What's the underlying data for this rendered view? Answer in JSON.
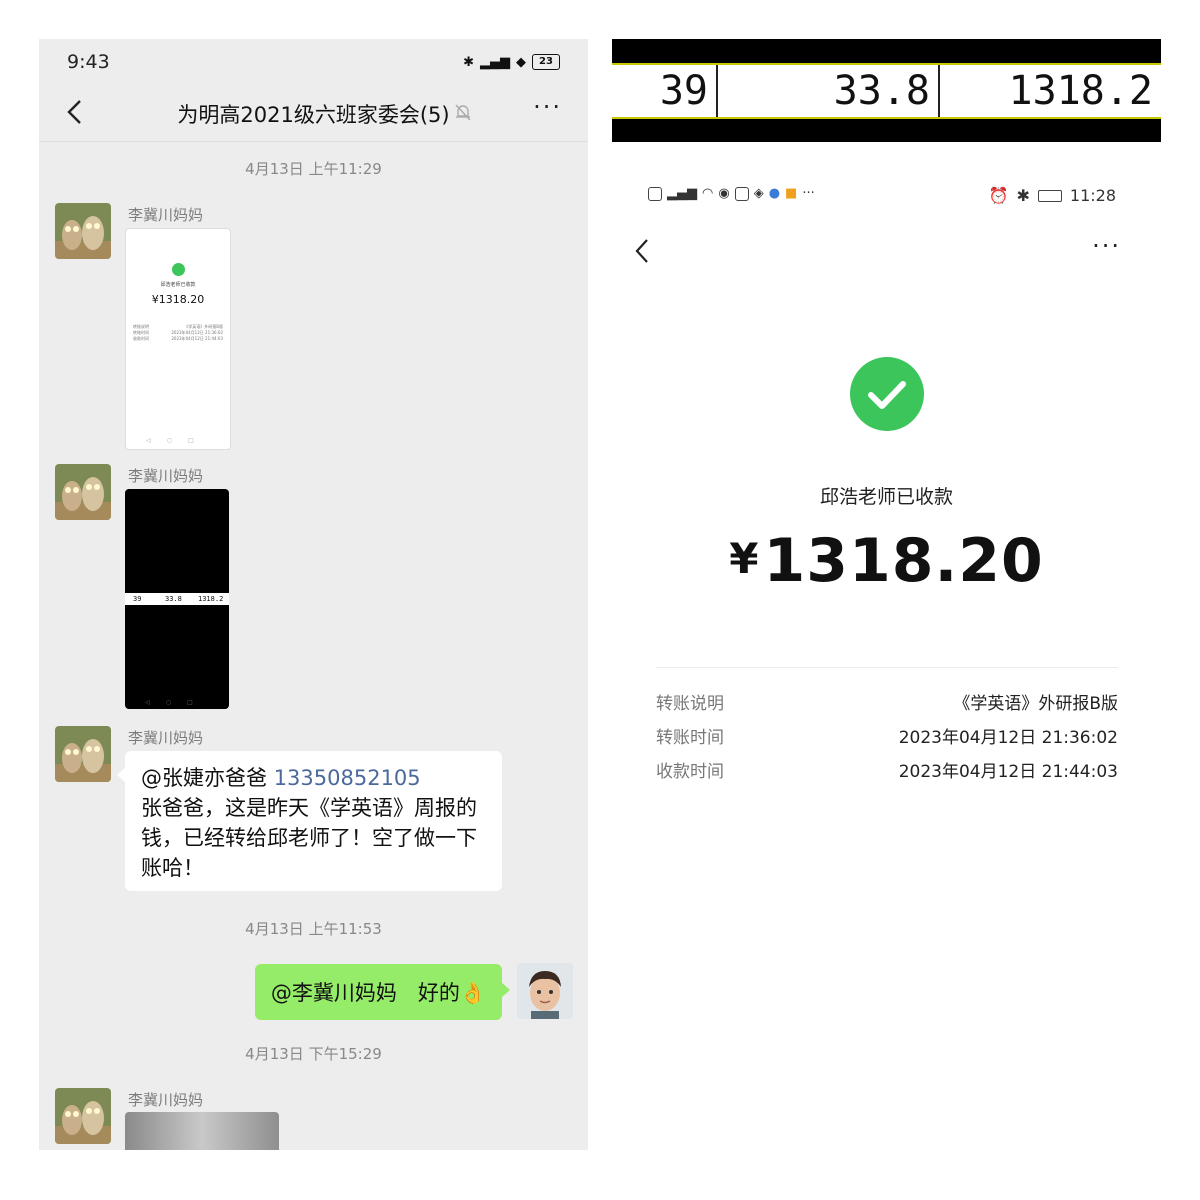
{
  "chat": {
    "status_bar": {
      "time": "9:43",
      "battery": "23"
    },
    "header": {
      "title": "为明高2021级六班家委会(5)"
    },
    "messages": [
      {
        "timestamp": "4月13日 上午11:29"
      },
      {
        "sender": "李冀川妈妈",
        "kind": "image",
        "thumb": {
          "check_title": "邱浩老师已收款",
          "amount": "¥1318.20",
          "rows": [
            {
              "k": "转账说明",
              "v": "《学英语》外研报B版"
            },
            {
              "k": "转账时间",
              "v": "2023年04月12日 21:36:02"
            },
            {
              "k": "收款时间",
              "v": "2023年04月12日 21:44:03"
            }
          ]
        }
      },
      {
        "sender": "李冀川妈妈",
        "kind": "image",
        "strip": [
          "39",
          "33.8",
          "1318.2"
        ]
      },
      {
        "sender": "李冀川妈妈",
        "kind": "text",
        "mention": "@张婕亦爸爸",
        "mention_number": "13350852105",
        "text": "张爸爸，这是昨天《学英语》周报的钱，已经转给邱老师了！空了做一下账哈！"
      },
      {
        "timestamp": "4月13日 上午11:53"
      },
      {
        "sender": "me",
        "kind": "text",
        "text": "@李冀川妈妈　好的👌"
      },
      {
        "timestamp": "4月13日 下午15:29"
      },
      {
        "sender": "李冀川妈妈",
        "kind": "image"
      }
    ]
  },
  "strip": {
    "cells": [
      "39",
      "33.8",
      "1318.2"
    ]
  },
  "payment": {
    "status_bar": {
      "time": "11:28"
    },
    "received_text": "邱浩老师已收款",
    "currency": "¥",
    "amount": "1318.20",
    "details": [
      {
        "label": "转账说明",
        "value": "《学英语》外研报B版"
      },
      {
        "label": "转账时间",
        "value": "2023年04月12日 21:36:02"
      },
      {
        "label": "收款时间",
        "value": "2023年04月12日 21:44:03"
      }
    ]
  },
  "colors": {
    "chat_bg": "#ededed",
    "green_bubble": "#95ec69",
    "check_green": "#3cc55b",
    "mention_blue": "#4b6a9b"
  }
}
